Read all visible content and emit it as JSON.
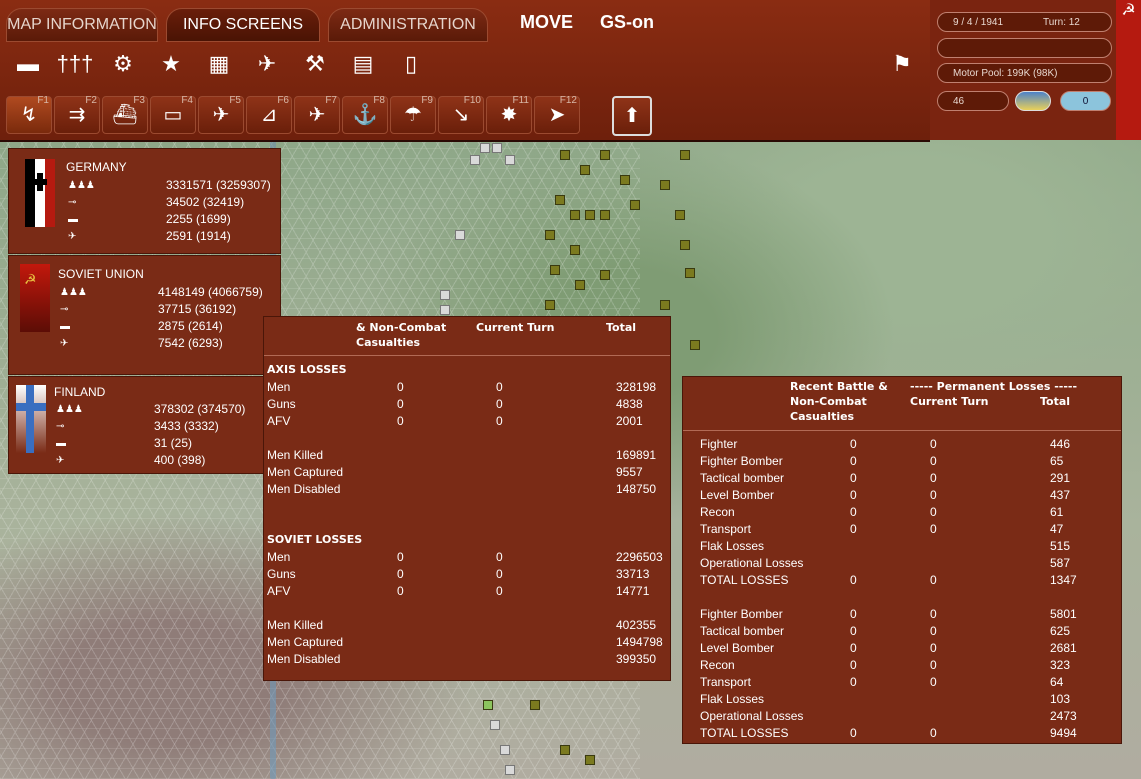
{
  "tabs": [
    {
      "label": "MAP INFORMATION"
    },
    {
      "label": "INFO SCREENS"
    },
    {
      "label": "ADMINISTRATION"
    }
  ],
  "mode": {
    "move": "MOVE",
    "gs": "GS-on"
  },
  "toolbar_icons": [
    "tank-icon",
    "troops-icon",
    "gear-icon",
    "star-icon",
    "fort-icon",
    "aircraft-icon",
    "satellite-icon",
    "document-icon",
    "clipboard-icon"
  ],
  "fkeys": [
    "F1",
    "F2",
    "F3",
    "F4",
    "F5",
    "F6",
    "F7",
    "F8",
    "F9",
    "F10",
    "F11",
    "F12"
  ],
  "status": {
    "date": "9 / 4 / 1941",
    "turn": "Turn: 12",
    "motor_pool": "Motor Pool:  199K (98K)",
    "number": "46",
    "weather_value": "0"
  },
  "nations": [
    {
      "name": "GERMANY",
      "stats": [
        "3331571 (3259307)",
        "34502 (32419)",
        "2255 (1699)",
        "2591 (1914)"
      ]
    },
    {
      "name": "SOVIET UNION",
      "stats": [
        "4148149 (4066759)",
        "37715 (36192)",
        "2875 (2614)",
        "7542 (6293)"
      ]
    },
    {
      "name": "FINLAND",
      "stats": [
        "378302 (374570)",
        "3433 (3332)",
        "31 (25)",
        "400 (398)"
      ]
    }
  ],
  "ground": {
    "headers": {
      "col1": "& Non-Combat Casualties",
      "col2": "Current Turn",
      "col3": "Total"
    },
    "axis_title": "AXIS LOSSES",
    "axis_rows": [
      {
        "label": "Men",
        "a": "0",
        "b": "0",
        "total": "328198"
      },
      {
        "label": "Guns",
        "a": "0",
        "b": "0",
        "total": "4838"
      },
      {
        "label": "AFV",
        "a": "0",
        "b": "0",
        "total": "2001"
      }
    ],
    "axis_extra": [
      {
        "label": "Men Killed",
        "total": "169891"
      },
      {
        "label": "Men Captured",
        "total": "9557"
      },
      {
        "label": "Men Disabled",
        "total": "148750"
      }
    ],
    "soviet_title": "SOVIET LOSSES",
    "soviet_rows": [
      {
        "label": "Men",
        "a": "0",
        "b": "0",
        "total": "2296503"
      },
      {
        "label": "Guns",
        "a": "0",
        "b": "0",
        "total": "33713"
      },
      {
        "label": "AFV",
        "a": "0",
        "b": "0",
        "total": "14771"
      }
    ],
    "soviet_extra": [
      {
        "label": "Men Killed",
        "total": "402355"
      },
      {
        "label": "Men Captured",
        "total": "1494798"
      },
      {
        "label": "Men Disabled",
        "total": "399350"
      }
    ]
  },
  "air": {
    "headers": {
      "col1": "Recent Battle & Non-Combat Casualties",
      "perm": "----- Permanent Losses -----",
      "col2": "Current Turn",
      "col3": "Total"
    },
    "axis_rows": [
      {
        "label": "Fighter",
        "a": "0",
        "b": "0",
        "total": "446"
      },
      {
        "label": "Fighter Bomber",
        "a": "0",
        "b": "0",
        "total": "65"
      },
      {
        "label": "Tactical bomber",
        "a": "0",
        "b": "0",
        "total": "291"
      },
      {
        "label": "Level Bomber",
        "a": "0",
        "b": "0",
        "total": "437"
      },
      {
        "label": "Recon",
        "a": "0",
        "b": "0",
        "total": "61"
      },
      {
        "label": "Transport",
        "a": "0",
        "b": "0",
        "total": "47"
      },
      {
        "label": "Flak Losses",
        "a": "",
        "b": "",
        "total": "515"
      },
      {
        "label": "Operational Losses",
        "a": "",
        "b": "",
        "total": "587"
      },
      {
        "label": "TOTAL LOSSES",
        "a": "0",
        "b": "0",
        "total": "1347"
      }
    ],
    "soviet_rows": [
      {
        "label": "Fighter Bomber",
        "a": "0",
        "b": "0",
        "total": "5801"
      },
      {
        "label": "Tactical bomber",
        "a": "0",
        "b": "0",
        "total": "625"
      },
      {
        "label": "Level Bomber",
        "a": "0",
        "b": "0",
        "total": "2681"
      },
      {
        "label": "Recon",
        "a": "0",
        "b": "0",
        "total": "323"
      },
      {
        "label": "Transport",
        "a": "0",
        "b": "0",
        "total": "64"
      },
      {
        "label": "Flak Losses",
        "a": "",
        "b": "",
        "total": "103"
      },
      {
        "label": "Operational Losses",
        "a": "",
        "b": "",
        "total": "2473"
      },
      {
        "label": "TOTAL LOSSES",
        "a": "0",
        "b": "0",
        "total": "9494"
      }
    ]
  }
}
